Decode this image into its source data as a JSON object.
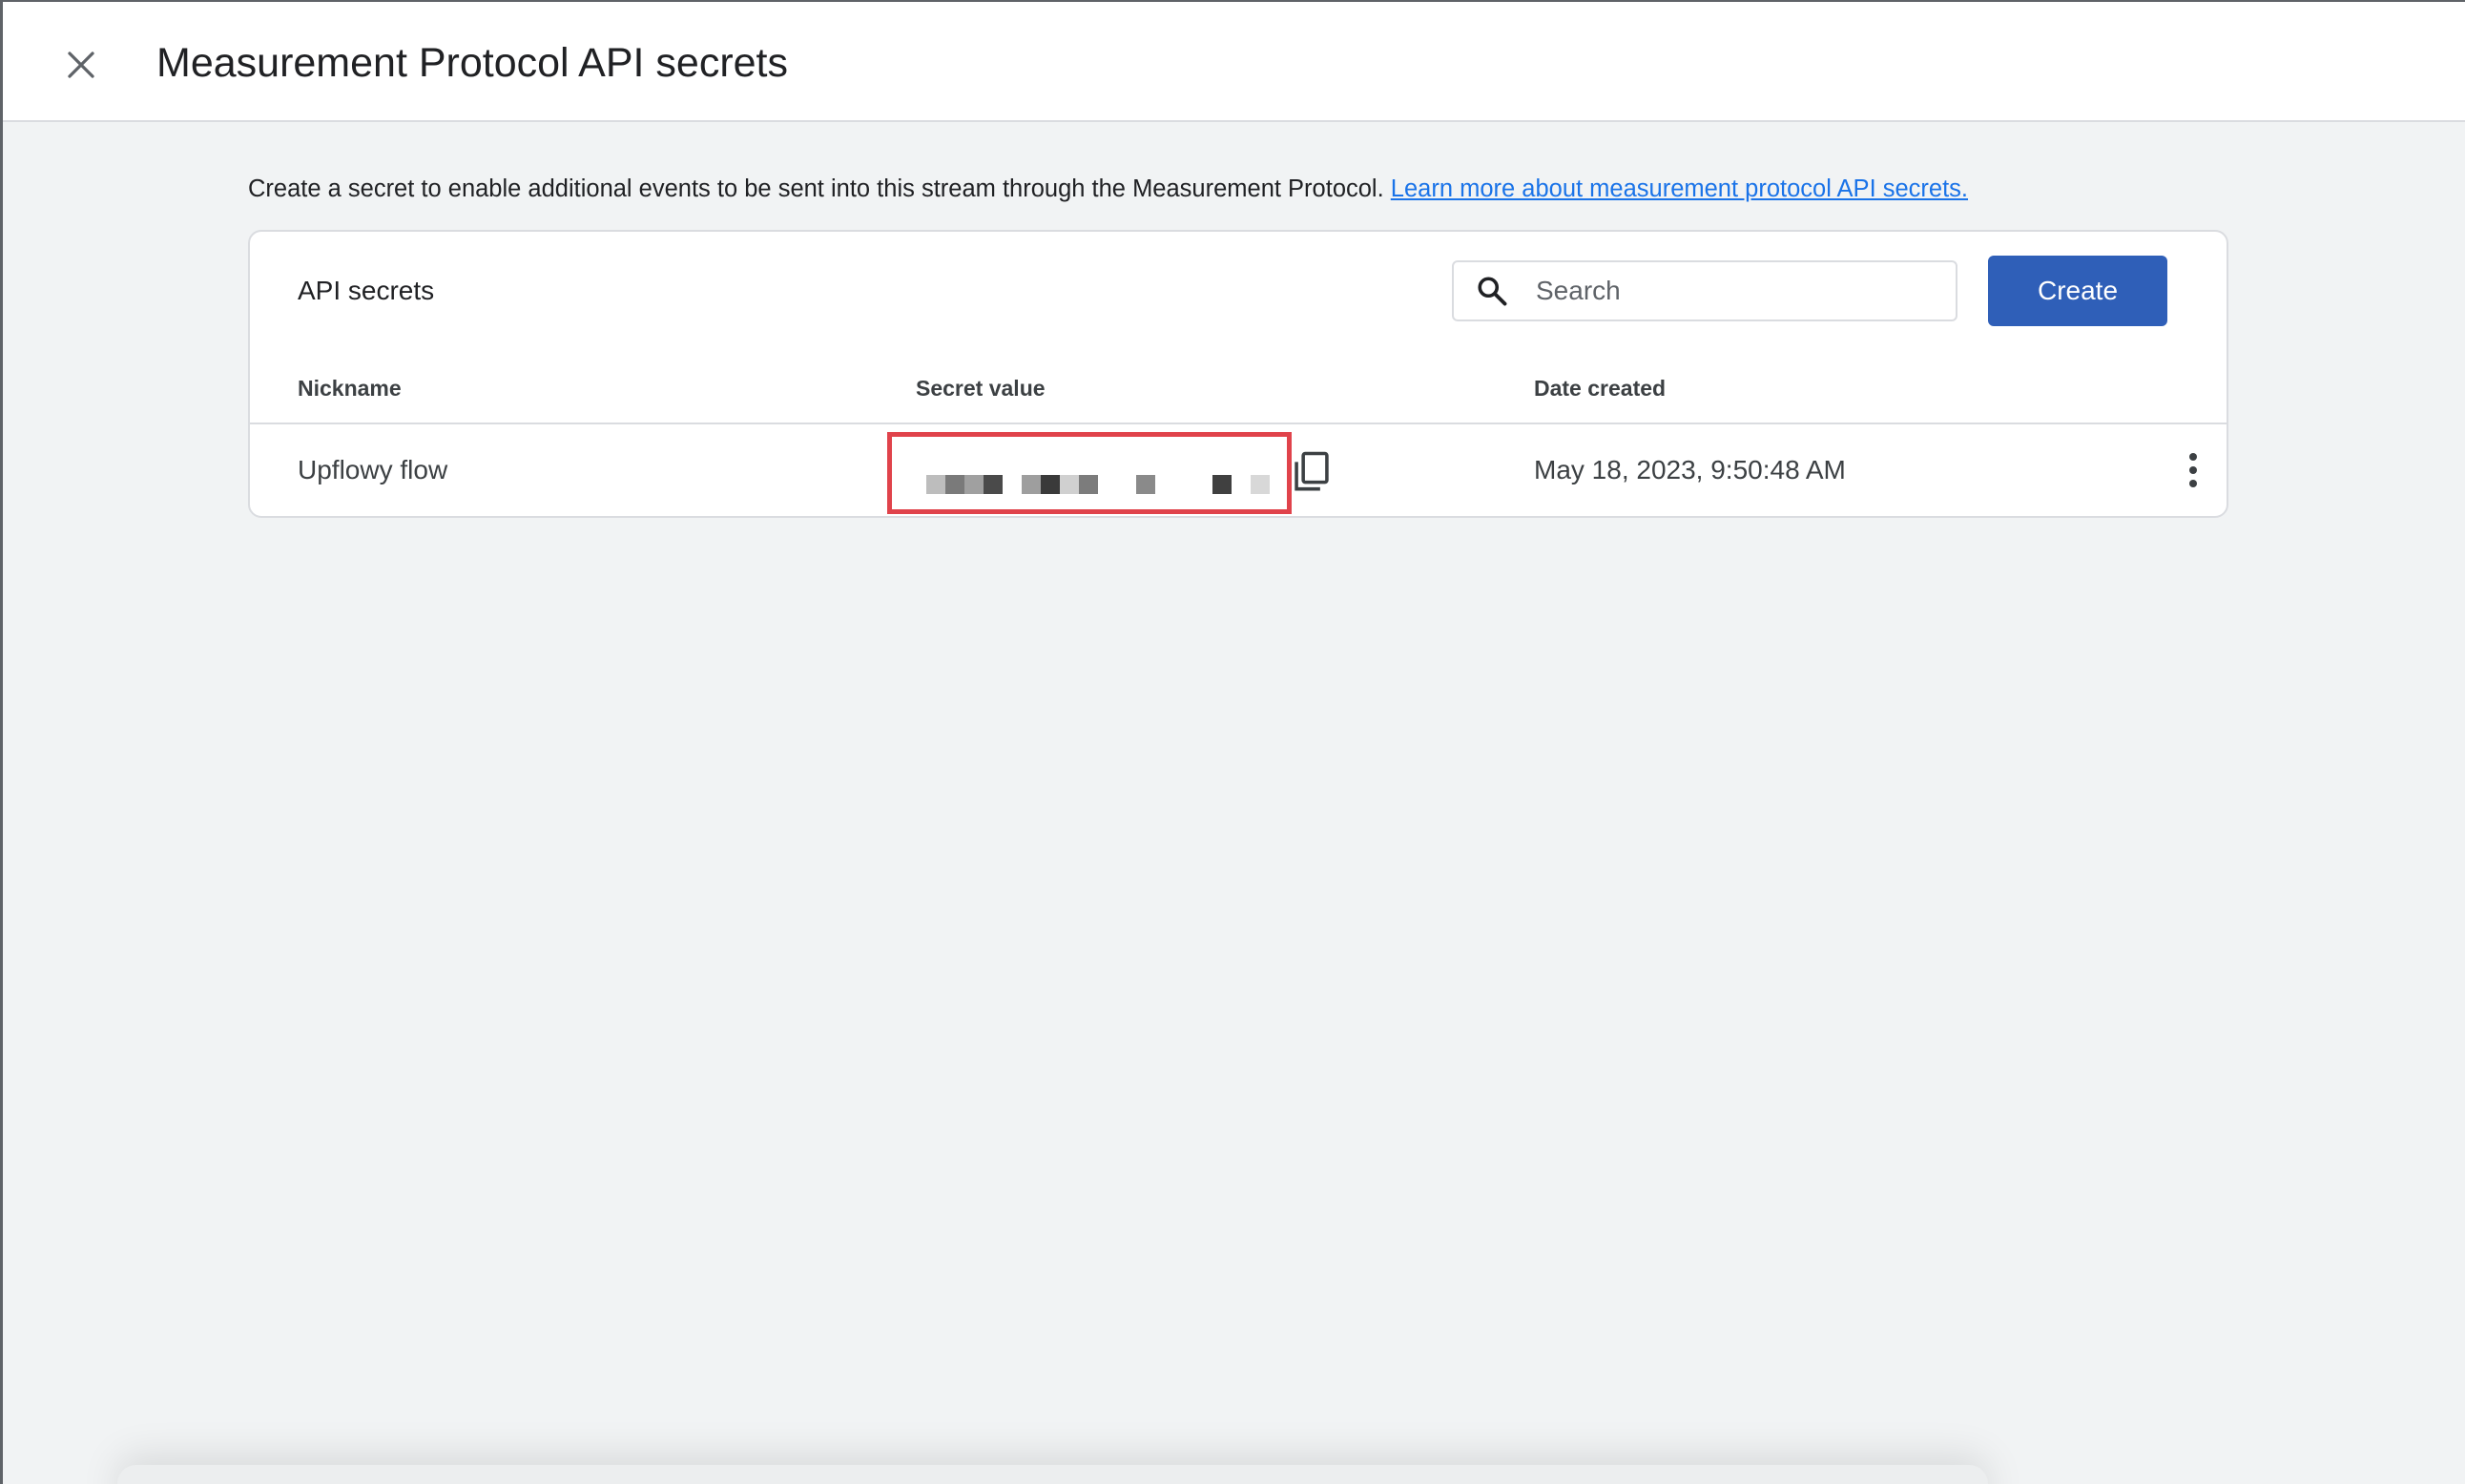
{
  "header": {
    "title": "Measurement Protocol API secrets",
    "close_icon": "close-icon"
  },
  "intro": {
    "text": "Create a secret to enable additional events to be sent into this stream through the Measurement Protocol.",
    "link_text": "Learn more about measurement protocol API secrets."
  },
  "card": {
    "title": "API secrets",
    "search": {
      "placeholder": "Search",
      "value": "",
      "icon": "search-icon"
    },
    "create_label": "Create",
    "columns": {
      "nickname": "Nickname",
      "secret_value": "Secret value",
      "date_created": "Date created"
    },
    "rows": [
      {
        "nickname": "Upflowy flow",
        "secret_value_state": "redacted (pixelated)",
        "date_created": "May 18, 2023, 9:50:48 AM"
      }
    ]
  },
  "colors": {
    "accent": "#2f5fb8",
    "link": "#1a73e8",
    "highlight_border": "#e0434b",
    "background": "#f1f3f4"
  }
}
